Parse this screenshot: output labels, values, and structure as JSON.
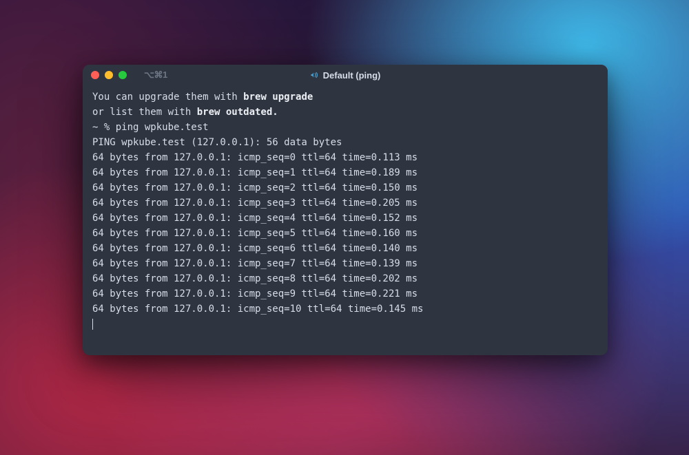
{
  "titlebar": {
    "tabIndicator": "⌥⌘1",
    "title": "Default (ping)"
  },
  "terminal": {
    "line1_prefix": "You can upgrade them with ",
    "line1_bold": "brew upgrade",
    "line2_prefix": "or list them with ",
    "line2_bold": "brew outdated.",
    "prompt": "~ % ping wpkube.test",
    "ping_header": "PING wpkube.test (127.0.0.1): 56 data bytes",
    "ping_lines": [
      "64 bytes from 127.0.0.1: icmp_seq=0 ttl=64 time=0.113 ms",
      "64 bytes from 127.0.0.1: icmp_seq=1 ttl=64 time=0.189 ms",
      "64 bytes from 127.0.0.1: icmp_seq=2 ttl=64 time=0.150 ms",
      "64 bytes from 127.0.0.1: icmp_seq=3 ttl=64 time=0.205 ms",
      "64 bytes from 127.0.0.1: icmp_seq=4 ttl=64 time=0.152 ms",
      "64 bytes from 127.0.0.1: icmp_seq=5 ttl=64 time=0.160 ms",
      "64 bytes from 127.0.0.1: icmp_seq=6 ttl=64 time=0.140 ms",
      "64 bytes from 127.0.0.1: icmp_seq=7 ttl=64 time=0.139 ms",
      "64 bytes from 127.0.0.1: icmp_seq=8 ttl=64 time=0.202 ms",
      "64 bytes from 127.0.0.1: icmp_seq=9 ttl=64 time=0.221 ms",
      "64 bytes from 127.0.0.1: icmp_seq=10 ttl=64 time=0.145 ms"
    ]
  }
}
